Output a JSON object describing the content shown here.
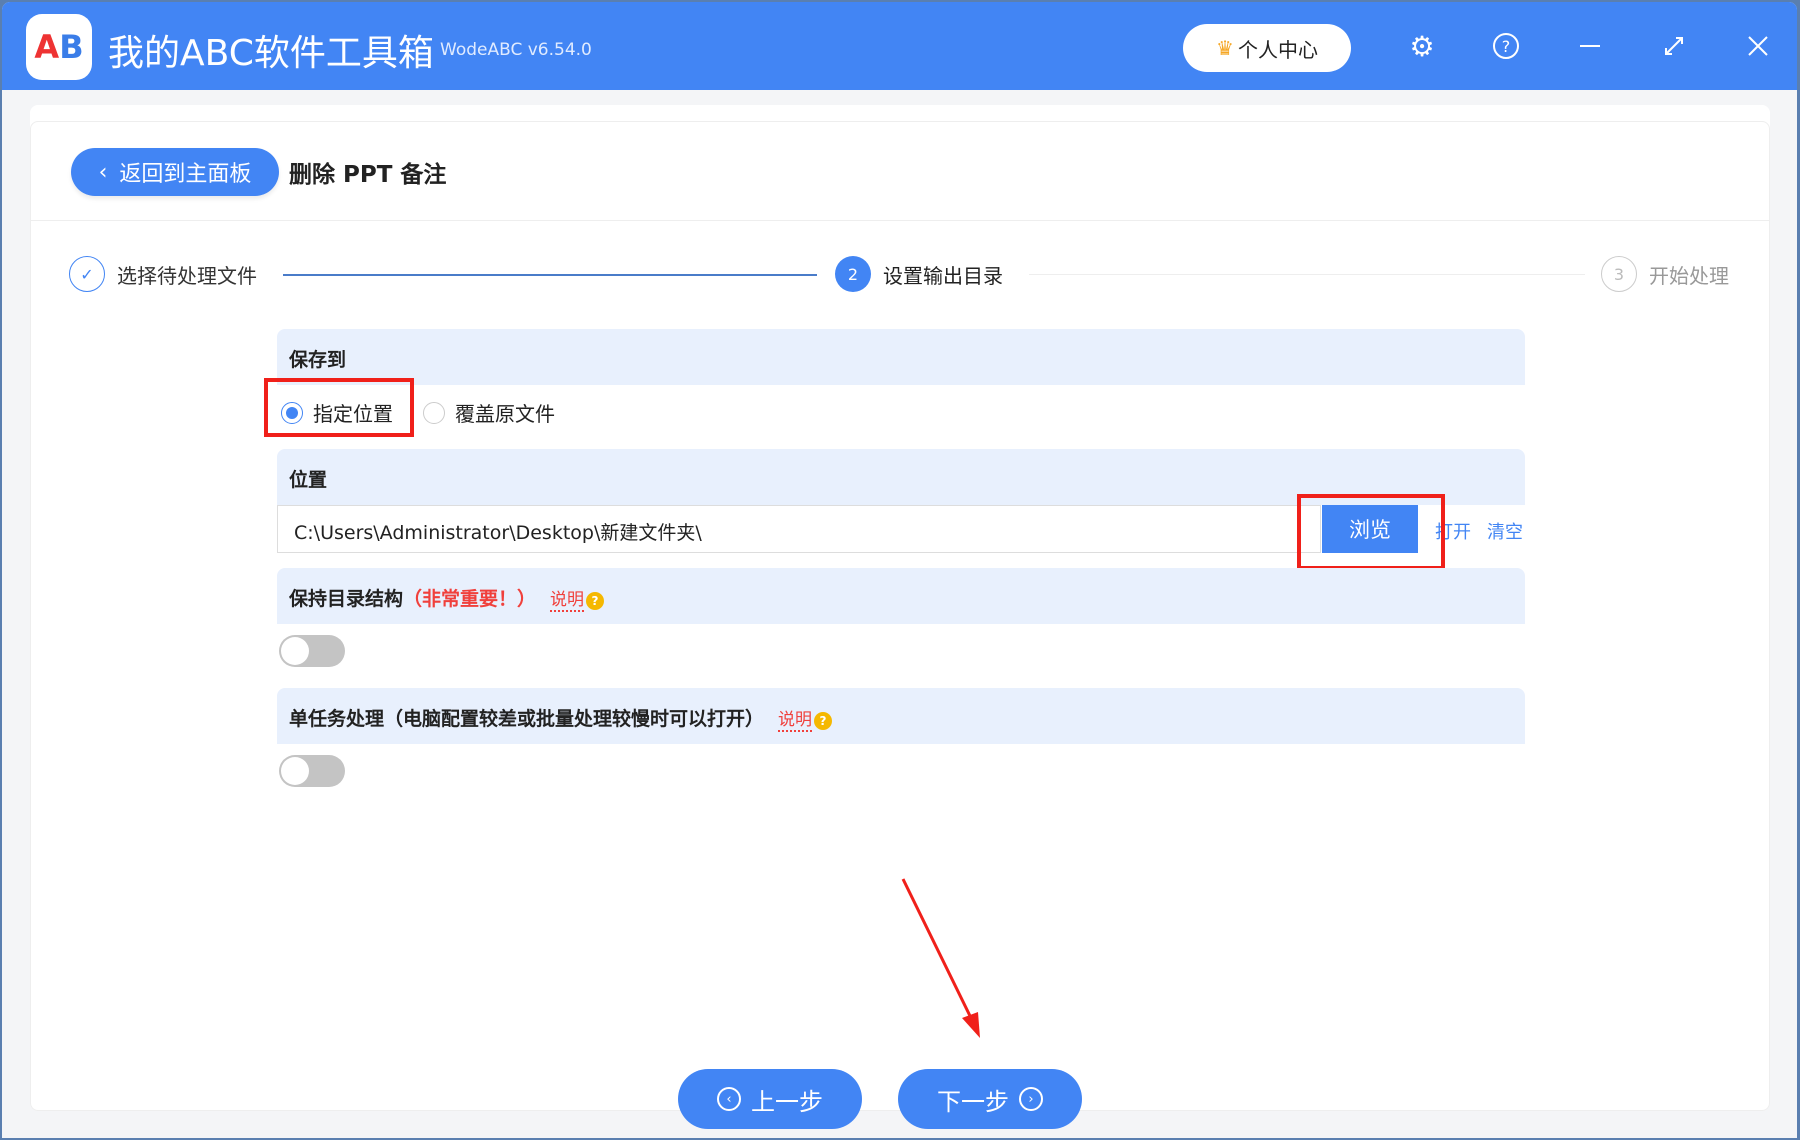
{
  "app": {
    "title": "我的ABC软件工具箱",
    "version": "WodeABC v6.54.0",
    "logo_text": "AB",
    "user_center": "个人中心"
  },
  "header": {
    "back_label": "返回到主面板",
    "page_title": "删除 PPT 备注"
  },
  "steps": [
    {
      "label": "选择待处理文件",
      "state": "done"
    },
    {
      "number": "2",
      "label": "设置输出目录",
      "state": "active"
    },
    {
      "number": "3",
      "label": "开始处理",
      "state": "pending"
    }
  ],
  "save_to": {
    "title": "保存到",
    "options": [
      "指定位置",
      "覆盖原文件"
    ],
    "selected": 0
  },
  "location": {
    "title": "位置",
    "value": "C:\\Users\\Administrator\\Desktop\\新建文件夹\\",
    "browse": "浏览",
    "open": "打开",
    "clear": "清空"
  },
  "keep_structure": {
    "title": "保持目录结构",
    "warning": "（非常重要！）",
    "help": "说明",
    "enabled": false
  },
  "single_task": {
    "title": "单任务处理（电脑配置较差或批量处理较慢时可以打开）",
    "help": "说明",
    "enabled": false
  },
  "nav": {
    "prev": "上一步",
    "next": "下一步"
  },
  "colors": {
    "accent": "#4285f4",
    "annotation": "#f0201a"
  }
}
